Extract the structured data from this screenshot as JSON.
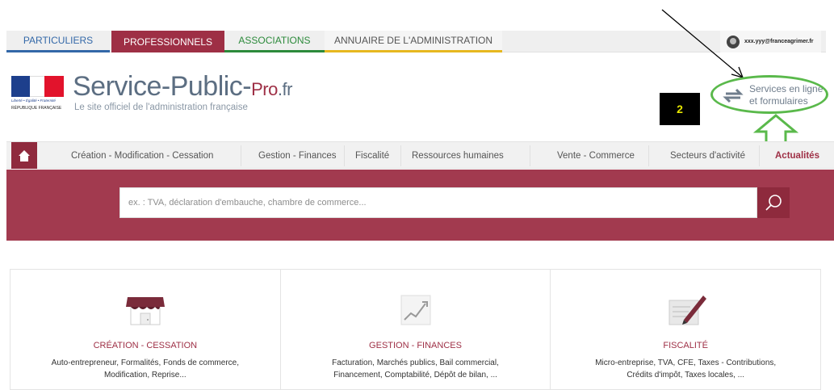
{
  "top_tabs": {
    "particuliers": "PARTICULIERS",
    "professionnels": "PROFESSIONNELS",
    "associations": "ASSOCIATIONS",
    "annuaire": "ANNUAIRE DE L'ADMINISTRATION"
  },
  "user": {
    "email": "xxx.yyy@franceagrimer.fr"
  },
  "header": {
    "motto": "Liberté • Égalité • Fraternité",
    "republique": "RÉPUBLIQUE FRANÇAISE",
    "title_main": "Service-Public-",
    "title_pro": "Pro",
    "title_fr": ".fr",
    "tagline": "Le site officiel de l'administration française",
    "services_line1": "Services en ligne",
    "services_line2": "et formulaires"
  },
  "annotation": {
    "label": "2",
    "circle_color": "#5ab94b",
    "box_text_color": "#e6e600"
  },
  "nav": {
    "items": [
      "Création - Modification - Cessation",
      "Gestion - Finances",
      "Fiscalité",
      "Ressources humaines",
      "Vente - Commerce",
      "Secteurs d'activité",
      "Actualités"
    ]
  },
  "search": {
    "placeholder": "ex. : TVA, déclaration d'embauche, chambre de commerce..."
  },
  "cards": [
    {
      "title": "CRÉATION - CESSATION",
      "desc1": "Auto-entrepreneur, Formalités, Fonds de commerce,",
      "desc2": "Modification, Reprise..."
    },
    {
      "title": "GESTION - FINANCES",
      "desc1": "Facturation, Marchés publics, Bail commercial,",
      "desc2": "Financement, Comptabilité, Dépôt de bilan, ..."
    },
    {
      "title": "FISCALITÉ",
      "desc1": "Micro-entreprise, TVA, CFE, Taxes - Contributions,",
      "desc2": "Crédits d'impôt, Taxes locales, ..."
    }
  ],
  "colors": {
    "brand": "#9e2f45",
    "band": "#a23a4f",
    "blue": "#3368a8",
    "green": "#2c8a3b",
    "yellow": "#e7b820"
  }
}
